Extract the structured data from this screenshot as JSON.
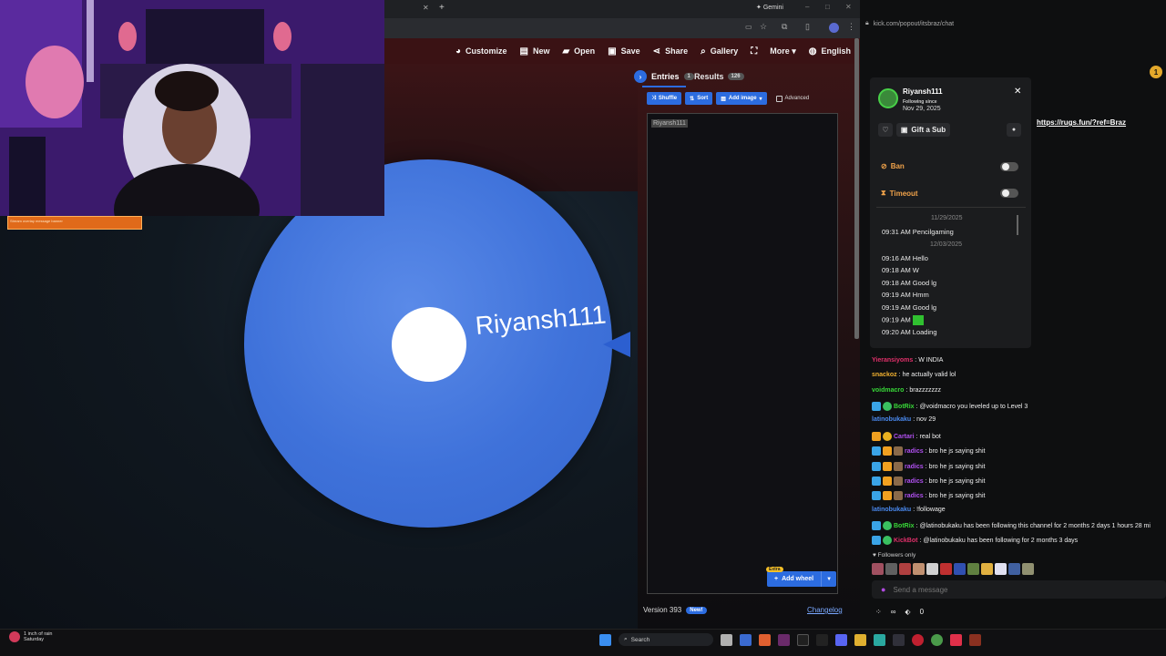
{
  "browser": {
    "tab_gemini": "Gemini",
    "toolbar": [
      {
        "icon": "palette-icon",
        "glyph": "◕",
        "label": "Customize"
      },
      {
        "icon": "new-file-icon",
        "glyph": "▤",
        "label": "New"
      },
      {
        "icon": "folder-icon",
        "glyph": "▰",
        "label": "Open"
      },
      {
        "icon": "save-icon",
        "glyph": "▣",
        "label": "Save"
      },
      {
        "icon": "share-icon",
        "glyph": "⋖",
        "label": "Share"
      },
      {
        "icon": "search-icon",
        "glyph": "⌕",
        "label": "Gallery"
      },
      {
        "icon": "fullscreen-icon",
        "glyph": "⛶",
        "label": ""
      },
      {
        "icon": "chevron-down-icon",
        "glyph": "",
        "label": "More ▾"
      },
      {
        "icon": "globe-icon",
        "glyph": "◍",
        "label": "English"
      }
    ]
  },
  "webcam": {
    "banner": "Stream overlay message banner"
  },
  "wheel": {
    "entry_label": "Riyansh111",
    "color": "#3f72da"
  },
  "panel": {
    "entries_label": "Entries",
    "entries_count": "1",
    "results_label": "Results",
    "results_count": "126",
    "shuffle": "Shuffle",
    "sort": "Sort",
    "add_image": "Add image",
    "advanced": "Advanced",
    "entry_text": "Riyansh111",
    "add_wheel": "Add wheel",
    "extra_badge": "Extra",
    "version": "Version 393",
    "new_badge": "New!",
    "changelog": "Changelog"
  },
  "chat": {
    "url": "kick.com/popout/itsbraz/chat",
    "link": "https://rugs.fun/?ref=Braz",
    "notif_count": "1",
    "user_card": {
      "name": "Riyansh111",
      "following_since": "Following since",
      "following_date": "Nov 29, 2025",
      "gift_sub": "Gift a Sub",
      "ban": "Ban",
      "timeout": "Timeout",
      "date1": "11/29/2025",
      "date2": "12/03/2025",
      "log": [
        {
          "time": "09:31 AM",
          "msg": "Pencilgaming"
        },
        {
          "time": "09:16 AM",
          "msg": "Hello"
        },
        {
          "time": "09:18 AM",
          "msg": "W"
        },
        {
          "time": "09:18 AM",
          "msg": "Good lg"
        },
        {
          "time": "09:19 AM",
          "msg": "Hmm"
        },
        {
          "time": "09:19 AM",
          "msg": "Good lg"
        },
        {
          "time": "09:19 AM",
          "msg": ""
        },
        {
          "time": "09:20 AM",
          "msg": "Loading"
        }
      ]
    },
    "messages": [
      {
        "user": "Yieransiyoms",
        "color": "#e0306a",
        "text": "W INDIA",
        "badges": []
      },
      {
        "user": "snackoz",
        "color": "#f0b030",
        "text": "he actually valid lol",
        "badges": []
      },
      {
        "user": "voidmacro",
        "color": "#38d838",
        "text": "brazzzzzzz",
        "badges": []
      },
      {
        "user": "BotRix",
        "color": "#38d838",
        "text": "@voidmacro you leveled up to Level 3",
        "badges": [
          "b-blue",
          "b-green"
        ]
      },
      {
        "user": "latinobukaku",
        "color": "#4a8af0",
        "text": "nov 29",
        "badges": []
      },
      {
        "user": "Cartari",
        "color": "#b050f0",
        "text": "real bot",
        "badges": [
          "b-gold",
          "b-orange"
        ]
      },
      {
        "user": "radics",
        "color": "#b050f0",
        "text": "bro he js saying shit",
        "badges": [
          "b-blue",
          "b-gold",
          "b-pic"
        ]
      },
      {
        "user": "radics",
        "color": "#b050f0",
        "text": "bro he js saying shit",
        "badges": [
          "b-blue",
          "b-gold",
          "b-pic"
        ]
      },
      {
        "user": "radics",
        "color": "#b050f0",
        "text": "bro he js saying shit",
        "badges": [
          "b-blue",
          "b-gold",
          "b-pic"
        ]
      },
      {
        "user": "radics",
        "color": "#b050f0",
        "text": "bro he js saying shit",
        "badges": [
          "b-blue",
          "b-gold",
          "b-pic"
        ]
      },
      {
        "user": "latinobukaku",
        "color": "#4a8af0",
        "text": "!followage",
        "badges": []
      },
      {
        "user": "BotRix",
        "color": "#38d838",
        "text": "@latinobukaku has been following this channel for 2 months 2 days 1 hours 28 mi",
        "badges": [
          "b-blue",
          "b-green"
        ]
      },
      {
        "user": "KickBot",
        "color": "#e0306a",
        "text": "@latinobukaku has been following for 2 months 3 days",
        "badges": [
          "b-blue",
          "b-green"
        ]
      }
    ],
    "followers_only": "♥ Followers only",
    "input_placeholder": "Send a message",
    "bottom_count": "0",
    "bottom_infinity": "∞"
  },
  "taskbar": {
    "weather_line1": "1 inch of rain",
    "weather_line2": "Saturday",
    "search": "Search"
  }
}
